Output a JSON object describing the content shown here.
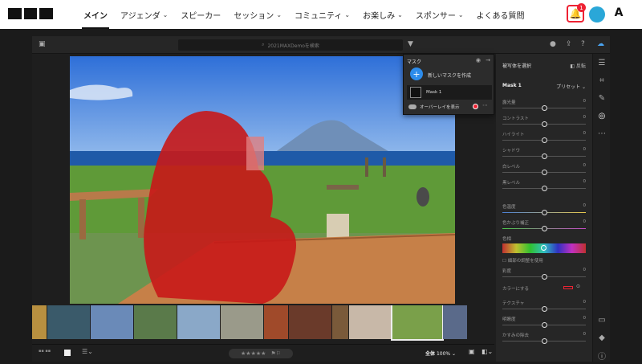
{
  "nav": {
    "items": [
      {
        "label": "メイン",
        "chev": ""
      },
      {
        "label": "アジェンダ",
        "chev": "⌄"
      },
      {
        "label": "スピーカー",
        "chev": ""
      },
      {
        "label": "セッション",
        "chev": "⌄"
      },
      {
        "label": "コミュニティ",
        "chev": "⌄"
      },
      {
        "label": "お楽しみ",
        "chev": "⌄"
      },
      {
        "label": "スポンサー",
        "chev": "⌄"
      },
      {
        "label": "よくある質問",
        "chev": ""
      }
    ],
    "notif_count": "1",
    "brand": "A"
  },
  "app": {
    "search_placeholder": "2021MAXDemoを検索",
    "mask_popup": {
      "title": "マスク",
      "create_label": "新しいマスクを作成",
      "mask_item": "Mask 1",
      "overlay_label": "オーバーレイを表示"
    },
    "panel": {
      "title": "被写体を選択",
      "invert_label": "反転",
      "mask_name": "Mask 1",
      "preset_label": "プリセット ⌄",
      "sliders": [
        "露光量",
        "コントラスト",
        "ハイライト",
        "シャドウ",
        "白レベル",
        "黒レベル",
        "色温度",
        "色かぶり補正",
        "色相",
        "彩度",
        "テクスチャ",
        "明瞭度",
        "かすみの除去"
      ],
      "hue_check_label": "細部の調整を使用",
      "color_label": "カラーにする"
    },
    "bottom": {
      "zoom_label": "全体",
      "zoom_value": "100%",
      "stars": "★★★★★"
    }
  },
  "colors": {
    "mask_overlay": "#c81818",
    "accent": "#2d8ceb"
  }
}
